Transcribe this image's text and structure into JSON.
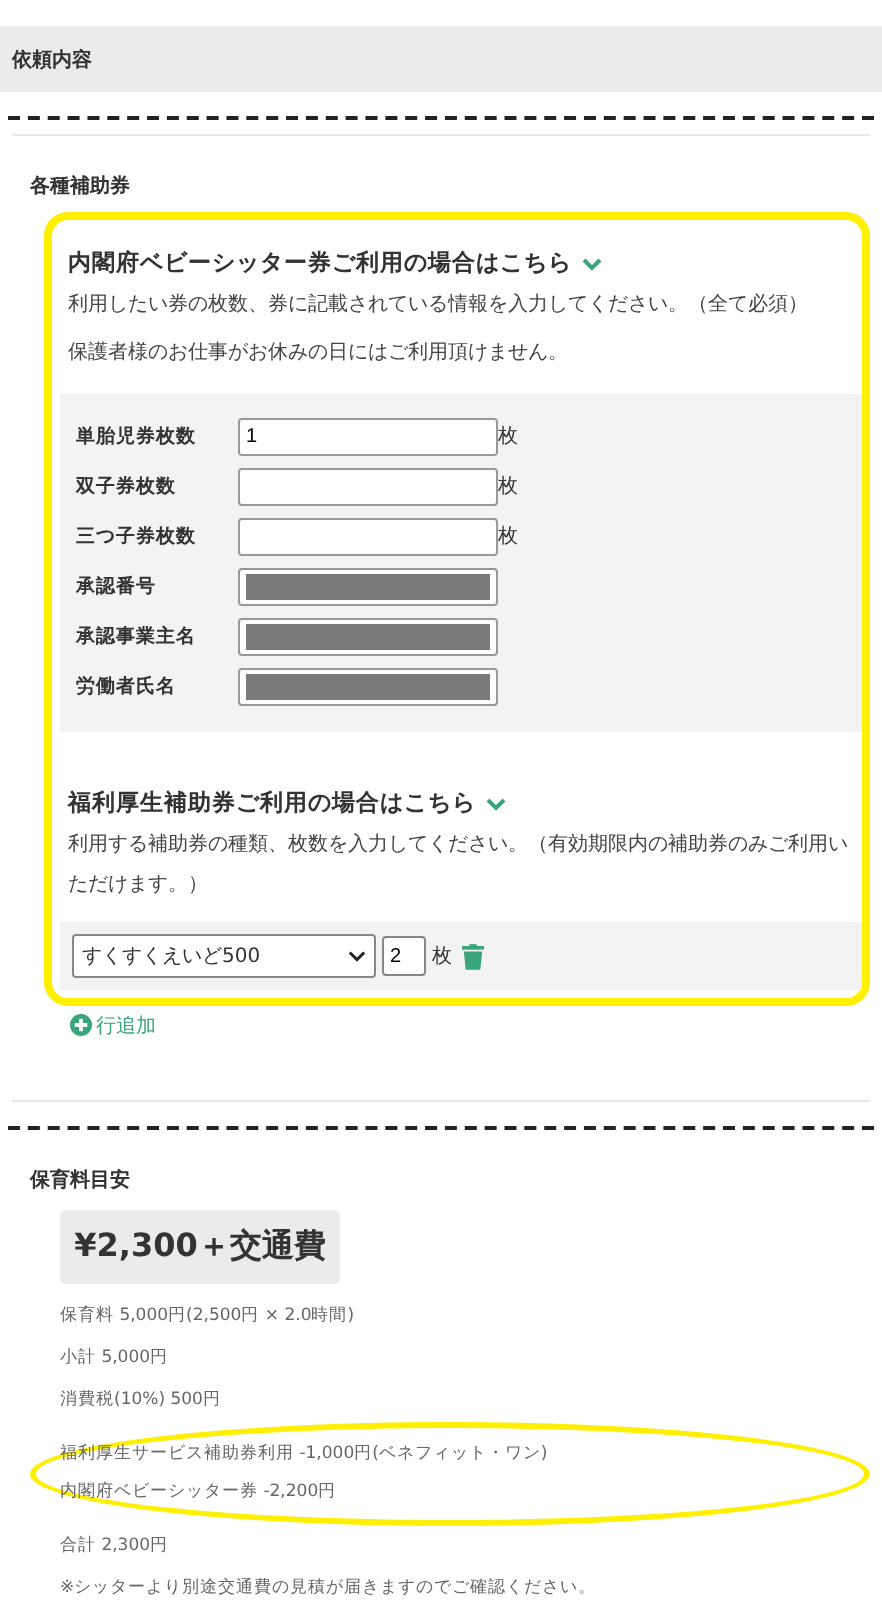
{
  "header": {
    "title": "依頼内容"
  },
  "vouchers": {
    "title": "各種補助券",
    "cabinet": {
      "title": "内閣府ベビーシッター券ご利用の場合はこちら",
      "expanded": true,
      "description": [
        "利用したい券の枚数、券に記載されている情報を入力してください。（全て必須）",
        "保護者様のお仕事がお休みの日にはご利用頂けません。"
      ],
      "fields": [
        {
          "label": "単胎児券枚数",
          "kind": "text",
          "value": "1",
          "unit": "枚"
        },
        {
          "label": "双子券枚数",
          "kind": "text",
          "unit": "枚"
        },
        {
          "label": "三つ子券枚数",
          "kind": "text",
          "unit": "枚"
        },
        {
          "label": "承認番号",
          "kind": "redacted"
        },
        {
          "label": "承認事業主名",
          "kind": "redacted"
        },
        {
          "label": "労働者氏名",
          "kind": "redacted"
        }
      ]
    },
    "welfare": {
      "title": "福利厚生補助券ご利用の場合はこちら",
      "expanded": true,
      "description": "利用する補助券の種類、枚数を入力してください。（有効期限内の補助券のみご利用いただけます。）",
      "rows": [
        {
          "voucher": "すくすくえいど500",
          "count": "2",
          "unit": "枚"
        }
      ],
      "add_label": "行追加"
    }
  },
  "estimate": {
    "title": "保育料目安",
    "price": "¥2,300＋交通費",
    "lines": [
      {
        "text": "保育料 5,000円(2,500円 × 2.0時間)",
        "highlighted": false
      },
      {
        "text": "小計 5,000円",
        "highlighted": false
      },
      {
        "text": "消費税(10%) 500円",
        "highlighted": false
      },
      {
        "text": "福利厚生サービス補助券利用 -1,000円(ベネフィット・ワン)",
        "highlighted": true
      },
      {
        "text": "内閣府ベビーシッター券 -2,200円",
        "highlighted": true
      },
      {
        "text": "合計 2,300円",
        "highlighted": false
      },
      {
        "text": "※シッターより別途交通費の見積が届きますのでご確認ください。",
        "highlighted": false
      }
    ]
  }
}
